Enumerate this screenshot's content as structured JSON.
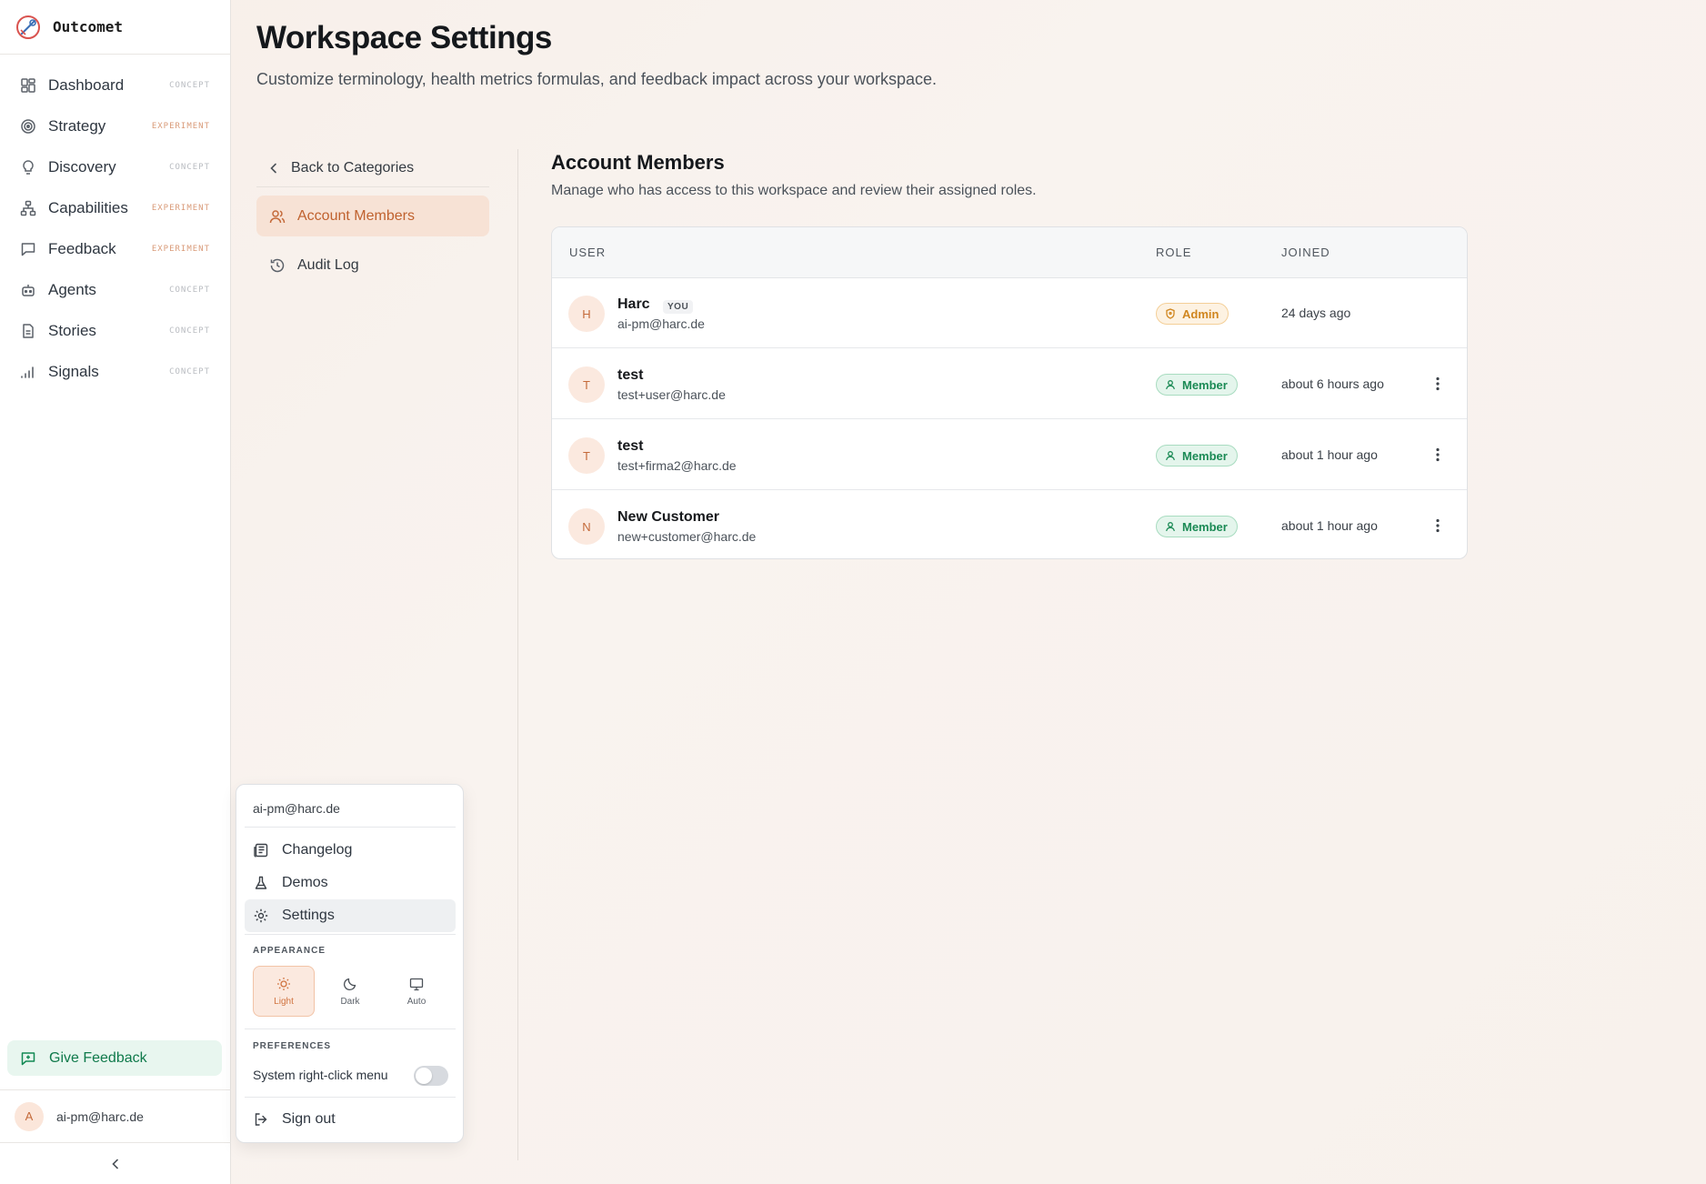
{
  "app": {
    "name": "Outcomet"
  },
  "sidebar": {
    "items": [
      {
        "label": "Dashboard",
        "tag": "CONCEPT",
        "icon": "dashboard-icon"
      },
      {
        "label": "Strategy",
        "tag": "EXPERIMENT",
        "icon": "target-icon"
      },
      {
        "label": "Discovery",
        "tag": "CONCEPT",
        "icon": "lightbulb-icon"
      },
      {
        "label": "Capabilities",
        "tag": "EXPERIMENT",
        "icon": "hierarchy-icon"
      },
      {
        "label": "Feedback",
        "tag": "EXPERIMENT",
        "icon": "message-icon"
      },
      {
        "label": "Agents",
        "tag": "CONCEPT",
        "icon": "bot-icon"
      },
      {
        "label": "Stories",
        "tag": "CONCEPT",
        "icon": "document-icon"
      },
      {
        "label": "Signals",
        "tag": "CONCEPT",
        "icon": "signal-bars-icon"
      }
    ],
    "give_feedback": "Give Feedback",
    "user_avatar": "A",
    "user_email": "ai-pm@harc.de"
  },
  "header": {
    "title": "Workspace Settings",
    "subtitle": "Customize terminology, health metrics formulas, and feedback impact across your workspace."
  },
  "settings_nav": {
    "back_label": "Back to Categories",
    "items": [
      {
        "label": "Account Members",
        "active": true
      },
      {
        "label": "Audit Log",
        "active": false
      }
    ]
  },
  "members": {
    "title": "Account Members",
    "subtitle": "Manage who has access to this workspace and review their assigned roles.",
    "columns": [
      "USER",
      "ROLE",
      "JOINED"
    ],
    "rows": [
      {
        "initial": "H",
        "name": "Harc",
        "you": "YOU",
        "email": "ai-pm@harc.de",
        "role": "Admin",
        "joined": "24 days ago"
      },
      {
        "initial": "T",
        "name": "test",
        "email": "test+user@harc.de",
        "role": "Member",
        "joined": "about 6 hours ago"
      },
      {
        "initial": "T",
        "name": "test",
        "email": "test+firma2@harc.de",
        "role": "Member",
        "joined": "about 1 hour ago"
      },
      {
        "initial": "N",
        "name": "New Customer",
        "email": "new+customer@harc.de",
        "role": "Member",
        "joined": "about 1 hour ago"
      }
    ]
  },
  "user_menu": {
    "email": "ai-pm@harc.de",
    "items": [
      {
        "label": "Changelog",
        "icon": "newspaper-icon"
      },
      {
        "label": "Demos",
        "icon": "flask-icon"
      },
      {
        "label": "Settings",
        "icon": "gear-icon",
        "active": true
      }
    ],
    "appearance_heading": "APPEARANCE",
    "themes": [
      {
        "label": "Light",
        "active": true
      },
      {
        "label": "Dark",
        "active": false
      },
      {
        "label": "Auto",
        "active": false
      }
    ],
    "preferences_heading": "PREFERENCES",
    "pref_label": "System right-click menu",
    "pref_enabled": false,
    "sign_out": "Sign out"
  },
  "colors": {
    "accent": "#c46a3a",
    "admin": "#d0861f",
    "member": "#1b8a55",
    "feedback": "#0f7a4b"
  }
}
